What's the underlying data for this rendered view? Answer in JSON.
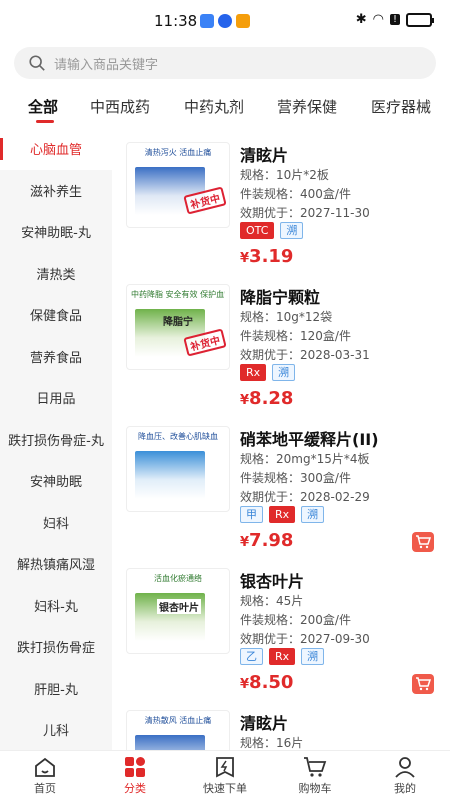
{
  "status_bar": {
    "time": "11:38"
  },
  "search": {
    "placeholder": "请输入商品关键字"
  },
  "top_tabs": [
    "全部",
    "中西成药",
    "中药丸剂",
    "营养保健",
    "医疗器械"
  ],
  "sidebar": {
    "items": [
      "心脑血管",
      "滋补养生",
      "安神助眠-丸",
      "清热类",
      "保健食品",
      "营养食品",
      "日用品",
      "跌打损伤骨症-丸",
      "安神助眠",
      "妇科",
      "解热镇痛风湿",
      "妇科-丸",
      "跌打损伤骨症",
      "肝胆-丸",
      "儿科"
    ]
  },
  "products": [
    {
      "name": "清眩片",
      "spec": "规格：10片*2板",
      "pack": "件装规格：400盒/件",
      "expiry": "效期优于：2027-11-30",
      "tags": [
        {
          "text": "OTC",
          "style": "red"
        },
        {
          "text": "溯",
          "style": "blue"
        }
      ],
      "price_symbol": "¥",
      "price": "3.19",
      "box_slogan": "清热泻火 活血止痛",
      "stamp": "补货中",
      "has_cart": false
    },
    {
      "name": "降脂宁颗粒",
      "spec": "规格：10g*12袋",
      "pack": "件装规格：120盒/件",
      "expiry": "效期优于：2028-03-31",
      "tags": [
        {
          "text": "Rx",
          "style": "red"
        },
        {
          "text": "溯",
          "style": "blue"
        }
      ],
      "price_symbol": "¥",
      "price": "8.28",
      "box_slogan": "中药降脂 安全有效 保护血管",
      "box_label": "降脂宁",
      "stamp": "补货中",
      "has_cart": false
    },
    {
      "name": "硝苯地平缓释片(II)",
      "spec": "规格：20mg*15片*4板",
      "pack": "件装规格：300盒/件",
      "expiry": "效期优于：2028-02-29",
      "tags": [
        {
          "text": "甲",
          "style": "blue"
        },
        {
          "text": "Rx",
          "style": "red"
        },
        {
          "text": "溯",
          "style": "blue"
        }
      ],
      "price_symbol": "¥",
      "price": "7.98",
      "box_slogan": "降血压、改善心肌缺血",
      "has_cart": true
    },
    {
      "name": "银杏叶片",
      "spec": "规格：45片",
      "pack": "件装规格：200盒/件",
      "expiry": "效期优于：2027-09-30",
      "tags": [
        {
          "text": "乙",
          "style": "blue"
        },
        {
          "text": "Rx",
          "style": "red"
        },
        {
          "text": "溯",
          "style": "blue"
        }
      ],
      "price_symbol": "¥",
      "price": "8.50",
      "box_slogan": "活血化瘀通络",
      "box_label": "银杏叶片",
      "has_cart": true
    },
    {
      "name": "清眩片",
      "spec": "规格：16片",
      "box_slogan": "清热散风 活血止痛",
      "has_cart": false
    }
  ],
  "bottom_nav": [
    "首页",
    "分类",
    "快速下单",
    "购物车",
    "我的"
  ],
  "colors": {
    "accent": "#e02a2a",
    "tag_blue": "#3a86d8",
    "sidebar_bg": "#f6f6f6"
  }
}
